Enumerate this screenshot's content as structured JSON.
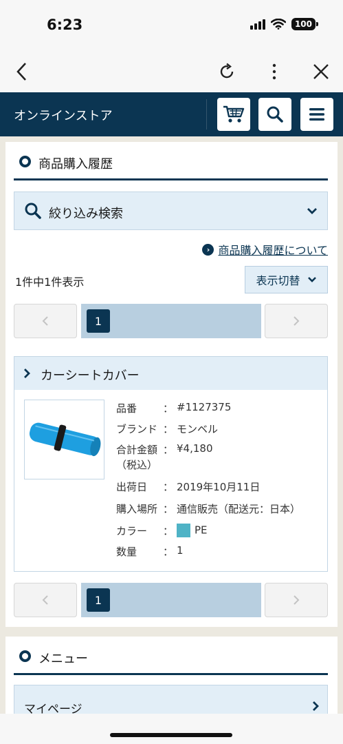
{
  "status_bar": {
    "time": "6:23",
    "battery": "100"
  },
  "header": {
    "title": "オンラインストア"
  },
  "section": {
    "title": "商品購入履歴"
  },
  "filter": {
    "label": "絞り込み検索"
  },
  "about_link": "商品購入履歴について",
  "results": {
    "count_text": "1件中1件表示",
    "switch_label": "表示切替"
  },
  "pagination": {
    "current_page": "1"
  },
  "product": {
    "name": "カーシートカバー",
    "details": [
      {
        "label": "品番",
        "colon": "：",
        "value": "#1127375"
      },
      {
        "label": "ブランド",
        "colon": "：",
        "value": "モンベル"
      },
      {
        "label": "合計金額",
        "colon": "：",
        "value": "¥4,180",
        "sublabel": "（税込）"
      },
      {
        "label": "出荷日",
        "colon": "：",
        "value": "2019年10月11日"
      },
      {
        "label": "購入場所",
        "colon": "：",
        "value": "通信販売（配送元：日本）"
      },
      {
        "label": "カラー",
        "colon": "：",
        "value": "PE"
      },
      {
        "label": "数量",
        "colon": "：",
        "value": "1"
      }
    ],
    "color_swatch": "#4fb3c6",
    "image_color": "#1e9fe0"
  },
  "menu": {
    "title": "メニュー",
    "items": [
      {
        "label": "マイページ"
      }
    ]
  },
  "colors": {
    "brand": "#0b3552",
    "light_blue": "#e2eef7",
    "pager_mid": "#b8cfe0"
  }
}
